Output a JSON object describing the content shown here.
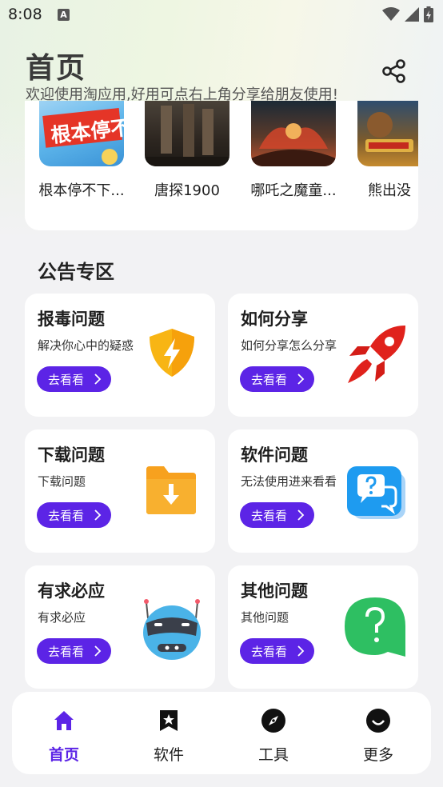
{
  "status_bar": {
    "time": "8:08",
    "notification_icon": "a-notification-icon"
  },
  "header": {
    "title": "首页",
    "subtitle": "欢迎使用淘应用,好用可点右上角分享给朋友使用!",
    "share_icon": "share-icon"
  },
  "movies": [
    {
      "label": "根本停不下..."
    },
    {
      "label": "唐探1900"
    },
    {
      "label": "哪吒之魔童..."
    },
    {
      "label": "熊出没"
    }
  ],
  "section": {
    "title": "公告专区"
  },
  "announcements": [
    {
      "title": "报毒问题",
      "desc": "解决你心中的疑惑",
      "button": "去看看",
      "icon": "shield-lightning-icon",
      "color": "#f8b514"
    },
    {
      "title": "如何分享",
      "desc": "如何分享怎么分享",
      "button": "去看看",
      "icon": "rocket-icon",
      "color": "#e0221c"
    },
    {
      "title": "下载问题",
      "desc": "下载问题",
      "button": "去看看",
      "icon": "download-folder-icon",
      "color": "#f79a1e"
    },
    {
      "title": "软件问题",
      "desc": "无法使用进来看看",
      "button": "去看看",
      "icon": "question-chat-icon",
      "color": "#1e9bf0"
    },
    {
      "title": "有求必应",
      "desc": "有求必应",
      "button": "去看看",
      "icon": "robot-icon",
      "color": "#4ab3e8"
    },
    {
      "title": "其他问题",
      "desc": "其他问题",
      "button": "去看看",
      "icon": "question-bubble-icon",
      "color": "#2ebf62"
    }
  ],
  "bottom_nav": [
    {
      "label": "首页",
      "icon": "home-icon",
      "active": true
    },
    {
      "label": "软件",
      "icon": "bookmark-star-icon",
      "active": false
    },
    {
      "label": "工具",
      "icon": "compass-icon",
      "active": false
    },
    {
      "label": "更多",
      "icon": "smile-icon",
      "active": false
    }
  ],
  "colors": {
    "accent": "#5c24e6",
    "background": "#f2f2f4"
  }
}
